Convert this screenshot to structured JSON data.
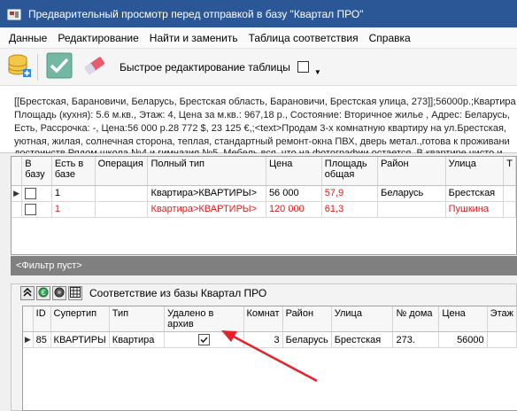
{
  "window": {
    "title": "Предварительный просмотр перед отправкой в базу \"Квартал ПРО\""
  },
  "menu": [
    {
      "label": "Данные"
    },
    {
      "label": "Редактирование"
    },
    {
      "label": "Найти и заменить"
    },
    {
      "label": "Таблица соответствия"
    },
    {
      "label": "Справка"
    }
  ],
  "toolbar": {
    "add_db_icon": "database-add-icon",
    "apply_icon": "checkmark-icon",
    "clear_icon": "eraser-icon",
    "quick_edit_label": "Быстрое редактирование таблицы",
    "quick_edit_checked": false
  },
  "text_preview": {
    "lines": [
      "[[Брестская, Барановичи, Беларусь, Брестская область, Барановичи, Брестская улица, 273]];56000р.;Квартира",
      "Площадь (кухня): 5.6 м.кв., Этаж: 4, Цена за м.кв.: 967,18 р., Состояние: Вторичное жилье , Адрес: Беларусь,",
      "Есть, Рассрочка: -, Цена:56 000 р.28 772 $, 23 125 €,;<text>Продам 3-х комнатную квартиру на ул.Брестская,",
      "уютная, жилая, солнечная сторона, теплая, стандартный ремонт-окна ПВХ, дверь метал.,готова к проживани",
      "достоинств Рядом школа №4 и гимназия №5. Мебель вся, что на фотографии остается. В квартире чисто и"
    ]
  },
  "grid_top": {
    "columns": [
      "В базу",
      "Есть в базе",
      "Операция",
      "Полный тип",
      "Цена",
      "Площадь общая",
      "Район",
      "Улица",
      "Т"
    ],
    "rows": [
      {
        "in_base": "1",
        "operation": "",
        "full_type": "Квартира>КВАРТИРЫ>",
        "price": "56 000",
        "area": "57,9",
        "district": "Беларусь",
        "street": "Брестская",
        "current": true,
        "red": false
      },
      {
        "in_base": "1",
        "operation": "",
        "full_type": "Квартира>КВАРТИРЫ>",
        "price": "120 000",
        "area": "61,3",
        "district": "",
        "street": "Пушкина",
        "current": false,
        "red": true
      }
    ]
  },
  "filter_bar": {
    "label": "<Фильтр пуст>"
  },
  "lower_panel": {
    "title": "Соответствие из базы Квартал ПРО",
    "columns": [
      "ID",
      "Супертип",
      "Тип",
      "Удалено в архив",
      "Комнат",
      "Район",
      "Улица",
      "№ дома",
      "Цена",
      "Этаж"
    ],
    "rows": [
      {
        "id": "85",
        "supertype": "КВАРТИРЫ",
        "type": "Квартира",
        "archived": true,
        "rooms": "3",
        "district": "Беларусь",
        "street": "Брестская",
        "house": "273.",
        "price": "56000",
        "floor": ""
      }
    ]
  },
  "colors": {
    "titlebar": "#2b5797",
    "red_row": "#e31b1b",
    "annotation_arrow": "#e8202a",
    "filter_bar": "#808080"
  }
}
